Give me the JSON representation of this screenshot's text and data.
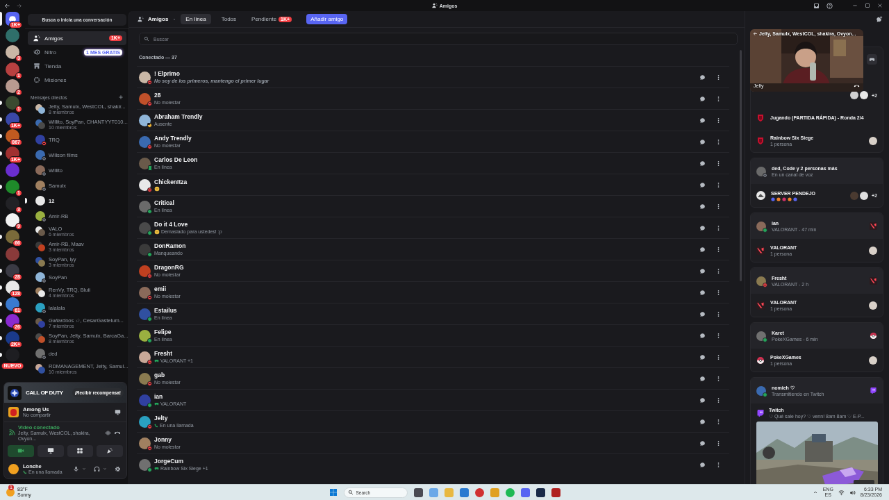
{
  "titlebar": {
    "title": "Amigos"
  },
  "servers": [
    {
      "kind": "home",
      "badge": "1K+",
      "selected": true,
      "unread": false
    },
    {
      "selected": false,
      "unread": false
    },
    {
      "badge": "3",
      "selected": false,
      "unread": false
    },
    {
      "badge": "1",
      "selected": false,
      "unread": false
    },
    {
      "badge": "2",
      "selected": false,
      "unread": false
    },
    {
      "badge": "1",
      "selected": false,
      "unread": true
    },
    {
      "badge": "1K+",
      "selected": false,
      "unread": true
    },
    {
      "badge": "867",
      "selected": false,
      "unread": true
    },
    {
      "badge": "1K+",
      "selected": false,
      "unread": true
    },
    {
      "selected": false,
      "unread": false
    },
    {
      "badge": "1",
      "selected": false,
      "unread": true
    },
    {
      "badge": "3",
      "selected": false,
      "unread": false
    },
    {
      "badge": "9",
      "selected": false,
      "unread": false
    },
    {
      "badge": "66",
      "selected": false,
      "unread": true
    },
    {
      "selected": false,
      "unread": false
    },
    {
      "badge": "28",
      "selected": false,
      "unread": true
    },
    {
      "badge": "128",
      "selected": false,
      "unread": true
    },
    {
      "badge": "61",
      "selected": false,
      "unread": true
    },
    {
      "badge": "26",
      "selected": false,
      "unread": true
    },
    {
      "badge": "2K+",
      "selected": false,
      "unread": true
    },
    {
      "kind": "new",
      "badge": "NUEVO",
      "selected": false,
      "unread": true
    }
  ],
  "sidebar": {
    "search": "Busca o inicia una conversación",
    "nav": [
      {
        "label": "Amigos",
        "badge": "1K+",
        "selected": true
      },
      {
        "label": "Nitro",
        "tag": "1 MES GRATIS",
        "selected": false
      },
      {
        "label": "Tienda",
        "selected": false
      },
      {
        "label": "Misiones",
        "selected": false
      }
    ],
    "dm_heading": "Mensajes directos",
    "dms": [
      {
        "name": "Jelty, Samulx, WestCOL, shakir...",
        "members": "8 miembros",
        "unread": false
      },
      {
        "name": "Willito, SoyPan, CHANTYYT010...",
        "members": "10 miembros",
        "unread": false
      },
      {
        "name": "TRQ",
        "status": {
          "kind": "dnd"
        },
        "unread": false
      },
      {
        "name": "Willson films",
        "status": {
          "kind": "offline"
        },
        "unread": false
      },
      {
        "name": "Willito",
        "status": {
          "kind": "offline"
        },
        "unread": false
      },
      {
        "name": "Samulx",
        "status": {
          "kind": "offline"
        },
        "unread": false
      },
      {
        "name": "12",
        "unread": true
      },
      {
        "name": "Amir-RB",
        "status": {
          "kind": "offline"
        },
        "unread": false
      },
      {
        "name": "VALO",
        "members": "6 miembros",
        "unread": false
      },
      {
        "name": "Amir-RB, Maav",
        "members": "3 miembros",
        "unread": false
      },
      {
        "name": "SoyPan, lyy",
        "members": "3 miembros",
        "unread": false
      },
      {
        "name": "SoyPan",
        "status": {
          "kind": "offline"
        },
        "unread": false
      },
      {
        "name": "RenVy, TRQ, Bluii",
        "members": "4 miembros",
        "unread": false
      },
      {
        "name": "lalalala",
        "status": {
          "kind": "offline"
        },
        "unread": false
      },
      {
        "name": "*Gallardoos ☆*, CesarGastelum...",
        "members": "7 miembros",
        "unread": false
      },
      {
        "name": "SoyPan, Jelty, Samulx, BarcaGa...",
        "members": "8 miembros",
        "unread": false
      },
      {
        "name": "ded",
        "status": {
          "kind": "offline"
        },
        "unread": false
      },
      {
        "name": "RDMANAGEMENT, Jelty, Samul...",
        "members": "10 miembros",
        "unread": false
      }
    ]
  },
  "promo": {
    "logo": "CALL OF DUTY",
    "button": "¡Recibir recompensa!"
  },
  "game": {
    "name": "Among Us",
    "detail": "No compartir"
  },
  "voice": {
    "title": "Video conectado",
    "channel": "Jelty, Samulx, WestCOL, shakira, Ovyon...",
    "camera_on": true
  },
  "user": {
    "name": "Lonche",
    "status": "En una llamada"
  },
  "friends": {
    "title": "Amigos",
    "tabs": [
      {
        "label": "En línea",
        "selected": true
      },
      {
        "label": "Todos",
        "selected": false
      },
      {
        "label": "Pendiente",
        "badge": "1K+",
        "selected": false
      }
    ],
    "add_button": "Añadir amigo",
    "search": {
      "placeholder": "Buscar"
    },
    "section": "Conectado — 37",
    "rows": [
      {
        "name": "! Elprimo",
        "status": {
          "kind": "dnd"
        },
        "activity": {
          "kind": "custom",
          "text": "No soy de los primeros, mantengo el primer lugar"
        }
      },
      {
        "name": "28",
        "status": {
          "kind": "dnd"
        },
        "activity": {
          "kind": "text",
          "text": "No molestar"
        }
      },
      {
        "name": "Abraham Trendly",
        "status": {
          "kind": "idle"
        },
        "activity": {
          "kind": "text",
          "text": "Ausente"
        }
      },
      {
        "name": "Andy Trendly",
        "status": {
          "kind": "dnd"
        },
        "activity": {
          "kind": "text",
          "text": "No molestar"
        }
      },
      {
        "name": "Carlos De Leon",
        "status": {
          "kind": "mobile"
        },
        "activity": {
          "kind": "text",
          "text": "En línea"
        }
      },
      {
        "name": "ChickenItza",
        "status": {
          "kind": "dnd"
        },
        "activity": {
          "kind": "emoji"
        }
      },
      {
        "name": "Critical",
        "status": {
          "kind": "online"
        },
        "activity": {
          "kind": "text",
          "text": "En línea"
        }
      },
      {
        "name": "Do it 4 Love",
        "status": {
          "kind": "online"
        },
        "activity": {
          "kind": "emoji",
          "text": "Demasiado para ustedes! :p"
        }
      },
      {
        "name": "DonRamon",
        "status": {
          "kind": "online"
        },
        "activity": {
          "kind": "text",
          "text": "Manqueando"
        }
      },
      {
        "name": "DragonRG",
        "status": {
          "kind": "dnd"
        },
        "activity": {
          "kind": "text",
          "text": "No molestar"
        }
      },
      {
        "name": "emii",
        "status": {
          "kind": "dnd"
        },
        "activity": {
          "kind": "text",
          "text": "No molestar"
        }
      },
      {
        "name": "Estailus",
        "status": {
          "kind": "online"
        },
        "activity": {
          "kind": "text",
          "text": "En línea"
        }
      },
      {
        "name": "Felipe",
        "status": {
          "kind": "online"
        },
        "activity": {
          "kind": "text",
          "text": "En línea"
        }
      },
      {
        "name": "Fresht",
        "status": {
          "kind": "dnd"
        },
        "activity": {
          "kind": "game",
          "text": "VALORANT +1"
        }
      },
      {
        "name": "gab",
        "status": {
          "kind": "dnd"
        },
        "activity": {
          "kind": "text",
          "text": "No molestar"
        }
      },
      {
        "name": "ian",
        "status": {
          "kind": "online"
        },
        "activity": {
          "kind": "game",
          "text": "VALORANT"
        }
      },
      {
        "name": "Jelty",
        "status": {
          "kind": "dnd"
        },
        "activity": {
          "kind": "call",
          "text": "En una llamada"
        }
      },
      {
        "name": "Jonny",
        "status": {
          "kind": "dnd"
        },
        "activity": {
          "kind": "text",
          "text": "No molestar"
        }
      },
      {
        "name": "JorgeCum",
        "status": {
          "kind": "online"
        },
        "activity": {
          "kind": "game",
          "text": "Rainbow Six Siege +1"
        }
      }
    ]
  },
  "active_now": {
    "video": {
      "title": "Jelty, Samulx, WestCOL, shakira, Ovyon...",
      "speaker": "Jelty"
    },
    "cards": [
      {
        "rows": [
          {
            "kind": "voice",
            "extra": "+2"
          },
          {
            "kind": "state",
            "title": "Jugando (PARTIDA RÁPIDA) - Ronda 2/4"
          },
          {
            "kind": "activity",
            "title": "Rainbow Six Siege",
            "subtitle": "1 persona"
          }
        ]
      },
      {
        "rows": [
          {
            "kind": "user",
            "title": "ded, Code y 2 personas más",
            "subtitle": "En un canal de voz",
            "status": {
              "kind": "offline"
            }
          },
          {
            "kind": "server",
            "title": "SERVER PENDEJO",
            "extra": "+2"
          }
        ]
      },
      {
        "rows": [
          {
            "kind": "user",
            "title": "ian",
            "subtitle": "VALORANT - 47 min",
            "status": {
              "kind": "online"
            }
          },
          {
            "kind": "activity",
            "title": "VALORANT",
            "subtitle": "1 persona"
          }
        ]
      },
      {
        "rows": [
          {
            "kind": "user",
            "title": "Fresht",
            "subtitle": "VALORANT - 2 h",
            "status": {
              "kind": "dnd"
            }
          },
          {
            "kind": "activity",
            "title": "VALORANT",
            "subtitle": "1 persona"
          }
        ]
      },
      {
        "rows": [
          {
            "kind": "user",
            "title": "Karet",
            "subtitle": "PokeXGames - 6 min",
            "status": {
              "kind": "online"
            }
          },
          {
            "kind": "activity",
            "title": "PokeXGames",
            "subtitle": "1 persona"
          }
        ]
      },
      {
        "rows": [
          {
            "kind": "user",
            "title": "nomieh ♡",
            "subtitle": "Transmitiendo en Twitch",
            "status": {
              "kind": "online"
            }
          },
          {
            "kind": "stream",
            "title": "Twitch",
            "subtitle": "♡ Qué sale hoy? ♡ venn! 8am 8am ♡ E-P..."
          }
        ]
      }
    ]
  },
  "taskbar": {
    "weather": {
      "badge": "1",
      "temp": "83°F",
      "condition": "Sunny"
    },
    "search": "Search",
    "lang": "ENG",
    "region": "ES",
    "time": "6:33 PM",
    "date": "8/23/2026"
  }
}
